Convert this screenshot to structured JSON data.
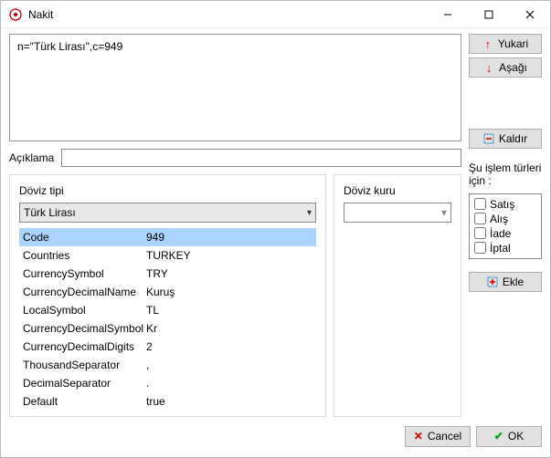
{
  "window": {
    "title": "Nakit"
  },
  "main_text": "n=\"Türk Lirası\",c=949",
  "labels": {
    "aciklama": "Açıklama",
    "doviz_tipi": "Döviz tipi",
    "doviz_kuru": "Döviz kuru",
    "islem_turleri": "Şu işlem türleri için  :"
  },
  "buttons": {
    "yukari": "Yukari",
    "asagi": "Aşağı",
    "kaldir": "Kaldır",
    "ekle": "Ekle",
    "cancel": "Cancel",
    "ok": "OK"
  },
  "currency_combo": {
    "selected": "Türk Lirası"
  },
  "properties": [
    {
      "key": "Code",
      "val": "949",
      "selected": true
    },
    {
      "key": "Countries",
      "val": "TURKEY"
    },
    {
      "key": "CurrencySymbol",
      "val": "TRY"
    },
    {
      "key": "CurrencyDecimalName",
      "val": "Kuruş"
    },
    {
      "key": "LocalSymbol",
      "val": "TL"
    },
    {
      "key": "CurrencyDecimalSymbol",
      "val": "Kr"
    },
    {
      "key": "CurrencyDecimalDigits",
      "val": "2"
    },
    {
      "key": "ThousandSeparator",
      "val": ","
    },
    {
      "key": "DecimalSeparator",
      "val": "."
    },
    {
      "key": "Default",
      "val": "true"
    }
  ],
  "transaction_types": [
    {
      "label": "Satış"
    },
    {
      "label": "Alış"
    },
    {
      "label": "İade"
    },
    {
      "label": "İptal"
    }
  ],
  "aciklama_value": "",
  "rate_value": ""
}
